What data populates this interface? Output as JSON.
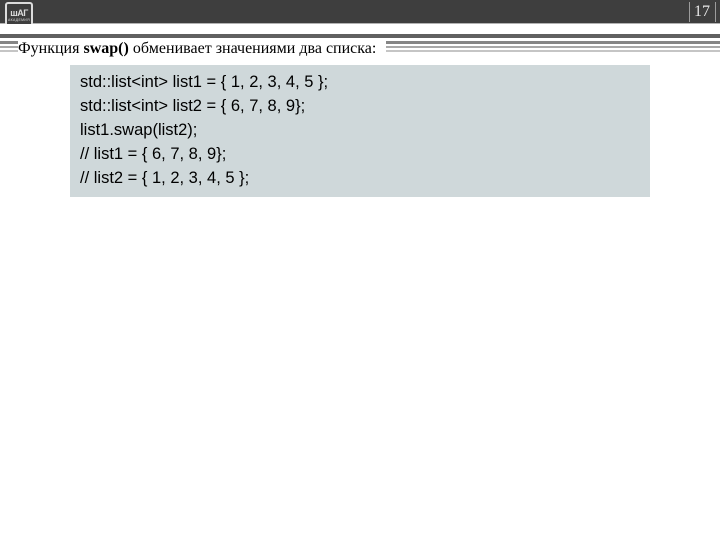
{
  "header": {
    "logo_text": "шАГ",
    "logo_sub": "АКАДЕМИЯ",
    "page_number": "17"
  },
  "intro": {
    "prefix": "Функция ",
    "func": "swap()",
    "suffix": " обменивает значениями два списка:"
  },
  "code": {
    "l1": "std::list<int> list1 = { 1, 2, 3, 4, 5 };",
    "l2": "std::list<int> list2 = { 6, 7, 8, 9};",
    "l3": "list1.swap(list2);",
    "l4": "// list1 = { 6, 7, 8, 9};",
    "l5": "// list2 = { 1, 2, 3, 4, 5 };"
  }
}
